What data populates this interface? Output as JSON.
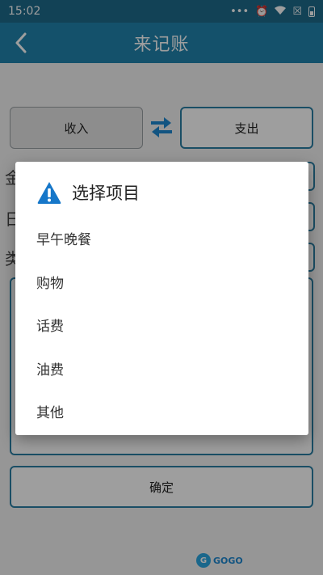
{
  "status_bar": {
    "time": "15:02"
  },
  "app_bar": {
    "title": "来记账",
    "back_icon": "chevron-left-icon"
  },
  "form": {
    "income_label": "收入",
    "expense_label": "支出",
    "swap_icon": "swap-arrows-icon",
    "amount_label": "金",
    "date_label": "日",
    "category_label": "类",
    "confirm_label": "确定"
  },
  "dialog": {
    "title": "选择项目",
    "icon": "warning-icon",
    "items": [
      "早午晚餐",
      "购物",
      "话费",
      "油费",
      "其他"
    ]
  },
  "watermark": {
    "text": "GOGO"
  },
  "colors": {
    "app_bar": "#2184ad",
    "status_bar": "#1e6b8b",
    "accent_border": "#2b7ea3",
    "icon_blue": "#1677c9"
  }
}
